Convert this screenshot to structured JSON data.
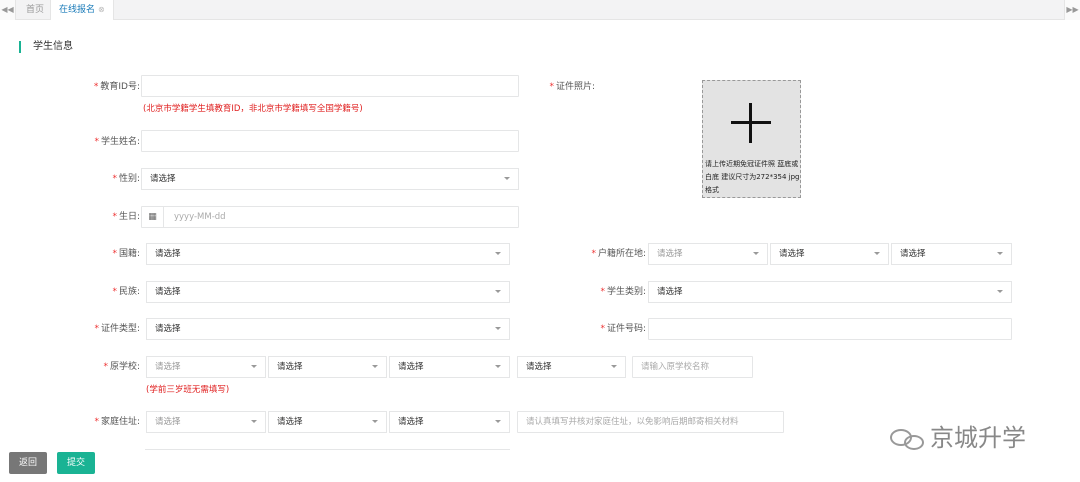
{
  "tabs": {
    "home": "首页",
    "active": "在线报名",
    "prev_icon": "double-left-arrow",
    "next_icon": "double-right-arrow",
    "close_glyph": "⊗"
  },
  "section_title": "学生信息",
  "fields": {
    "edu_id": {
      "label": "教育ID号:",
      "value": "",
      "hint": "(北京市学籍学生填教育ID，非北京市学籍填写全国学籍号)"
    },
    "name": {
      "label": "学生姓名:",
      "value": ""
    },
    "gender": {
      "label": "性别:",
      "value": "请选择"
    },
    "birthday": {
      "label": "生日:",
      "placeholder": "yyyy-MM-dd"
    },
    "nationality": {
      "label": "国籍:",
      "value": "请选择"
    },
    "ethnicity": {
      "label": "民族:",
      "value": "请选择"
    },
    "id_type": {
      "label": "证件类型:",
      "value": "请选择"
    },
    "origin_school": {
      "label": "原学校:",
      "values": [
        "请选择",
        "请选择",
        "请选择",
        "请选择"
      ],
      "name_placeholder": "请输入原学校名称",
      "hint": "(学前三岁班无需填写)"
    },
    "home_address": {
      "label": "家庭住址:",
      "values": [
        "请选择",
        "请选择",
        "请选择"
      ],
      "placeholder": "请认真填写并核对家庭住址，以免影响后期邮寄相关材料"
    },
    "photo": {
      "label": "证件照片:",
      "text": "请上传近期免冠证件照 蓝底或白底 建议尺寸为272*354 jpg格式"
    },
    "hukou": {
      "label": "户籍所在地:",
      "values": [
        "请选择",
        "请选择",
        "请选择"
      ]
    },
    "student_type": {
      "label": "学生类别:",
      "value": "请选择"
    },
    "id_number": {
      "label": "证件号码:",
      "value": ""
    }
  },
  "buttons": {
    "back": "返回",
    "submit": "提交"
  },
  "watermark": "京城升学",
  "colors": {
    "accent": "#1ab394",
    "required": "#e33333",
    "hint": "#e02020",
    "back_button": "#777777"
  }
}
